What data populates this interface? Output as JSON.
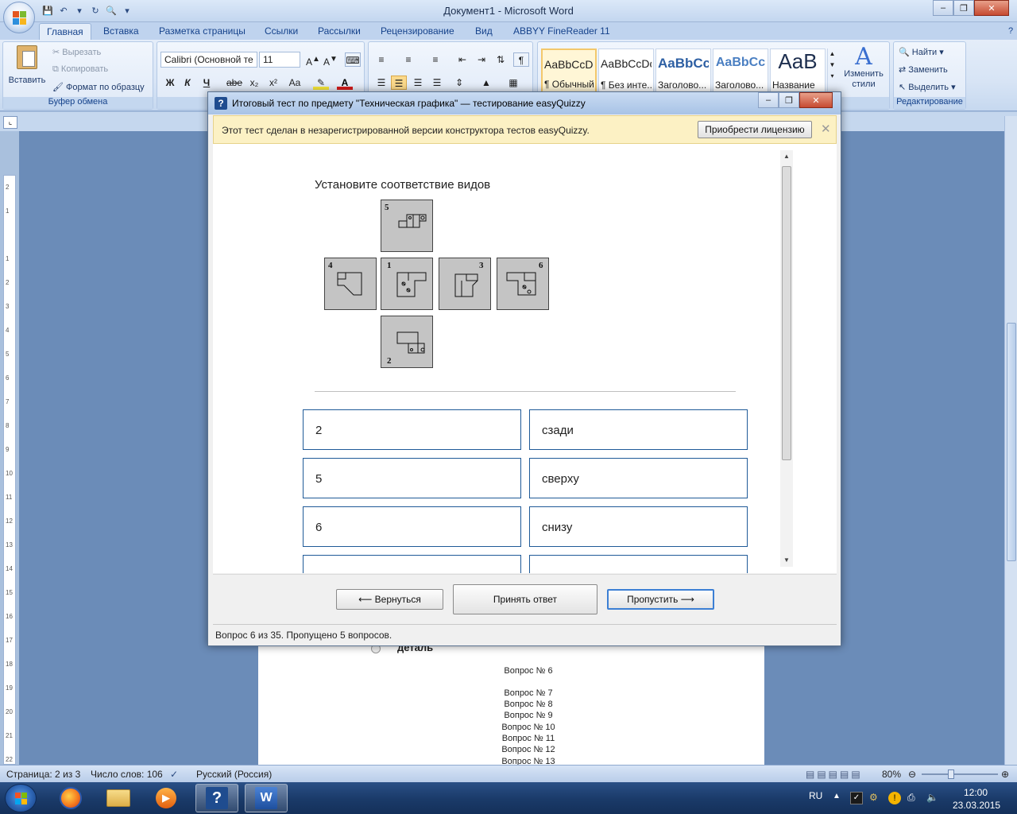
{
  "word": {
    "title": "Документ1 - Microsoft Word",
    "tabs": [
      "Главная",
      "Вставка",
      "Разметка страницы",
      "Ссылки",
      "Рассылки",
      "Рецензирование",
      "Вид",
      "ABBYY FineReader 11"
    ],
    "clipboard": {
      "paste": "Вставить",
      "cut": "Вырезать",
      "copy": "Копировать",
      "format_painter": "Формат по образцу",
      "group_label": "Буфер обмена"
    },
    "font": {
      "name": "Calibri (Основной те",
      "size": "11",
      "bold": "Ж",
      "italic": "К",
      "underline": "Ч",
      "strike": "abe",
      "subscript": "x₂",
      "superscript": "x²",
      "case": "Aa"
    },
    "styles": [
      {
        "preview": "AaBbCcDc",
        "name": "¶ Обычный"
      },
      {
        "preview": "AaBbCcDc",
        "name": "¶ Без инте..."
      },
      {
        "preview": "AaBbCс",
        "name": "Заголово..."
      },
      {
        "preview": "AaBbCc",
        "name": "Заголово..."
      },
      {
        "preview": "AaB",
        "name": "Название"
      }
    ],
    "change_styles": "Изменить стили",
    "editing": {
      "find": "Найти",
      "replace": "Заменить",
      "select": "Выделить",
      "group_label": "Редактирование"
    },
    "page": {
      "radio_label": "деталь",
      "question_list": [
        "Вопрос № 6",
        "Вопрос № 7",
        "Вопрос № 8",
        "Вопрос № 9",
        "Вопрос № 10",
        "Вопрос № 11",
        "Вопрос № 12",
        "Вопрос № 13"
      ]
    },
    "status": {
      "page": "Страница: 2 из 3",
      "words": "Число слов: 106",
      "language": "Русский (Россия)",
      "zoom": "80%"
    }
  },
  "dialog": {
    "title": "Итоговый тест по предмету \"Техническая графика\" — тестирование easyQuizzy",
    "notice": "Этот тест сделан в незарегистрированной версии конструктора тестов easyQuizzy.",
    "license_button": "Приобрести лицензию",
    "question": "Установите соответствие видов",
    "view_numbers": [
      "5",
      "4",
      "1",
      "3",
      "6",
      "2"
    ],
    "matches": [
      {
        "left": "2",
        "right": "сзади"
      },
      {
        "left": "5",
        "right": "сверху"
      },
      {
        "left": "6",
        "right": "снизу"
      }
    ],
    "buttons": {
      "back": "⟵ Вернуться",
      "accept": "Принять ответ",
      "skip": "Пропустить ⟶"
    },
    "status": "Вопрос 6 из 35. Пропущено 5 вопросов."
  },
  "taskbar": {
    "lang": "RU",
    "time": "12:00",
    "date": "23.03.2015"
  }
}
